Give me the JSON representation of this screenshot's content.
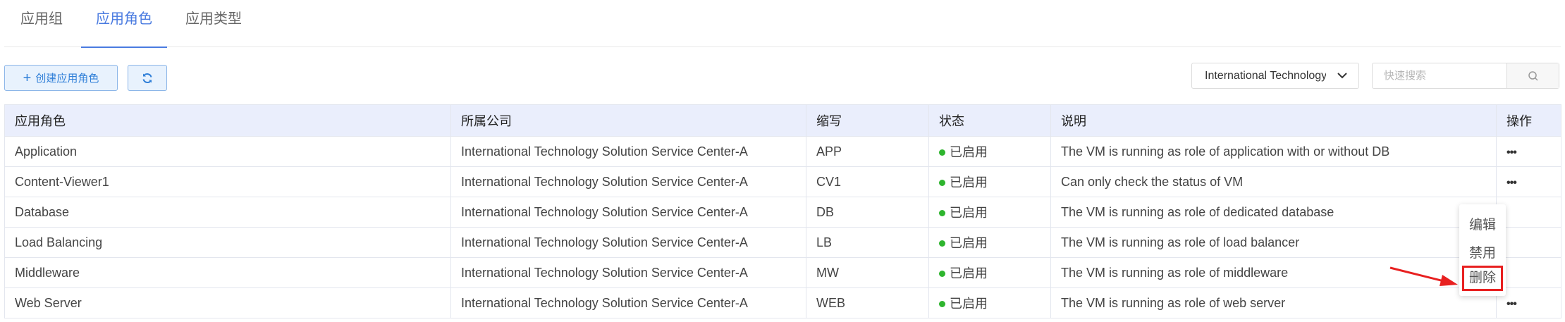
{
  "tabs": [
    {
      "label": "应用组",
      "active": false
    },
    {
      "label": "应用角色",
      "active": true
    },
    {
      "label": "应用类型",
      "active": false
    }
  ],
  "toolbar": {
    "create_label": "创建应用角色",
    "refresh_icon": "refresh-icon",
    "company_select": "International Technology Solution Service Center-A",
    "search_placeholder": "快速搜索",
    "search_icon": "search-icon"
  },
  "table": {
    "headers": [
      "应用角色",
      "所属公司",
      "缩写",
      "状态",
      "说明",
      "操作"
    ],
    "rows": [
      {
        "role": "Application",
        "company": "International Technology Solution Service Center-A",
        "abbr": "APP",
        "status": "已启用",
        "desc": "The VM is running as role of application with or without DB",
        "action": "•••"
      },
      {
        "role": "Content-Viewer1",
        "company": "International Technology Solution Service Center-A",
        "abbr": "CV1",
        "status": "已启用",
        "desc": "Can only check the status of VM",
        "action": "•••"
      },
      {
        "role": "Database",
        "company": "International Technology Solution Service Center-A",
        "abbr": "DB",
        "status": "已启用",
        "desc": "The VM is running as role of dedicated database",
        "action": ""
      },
      {
        "role": "Load Balancing",
        "company": "International Technology Solution Service Center-A",
        "abbr": "LB",
        "status": "已启用",
        "desc": "The VM is running as role of load balancer",
        "action": ""
      },
      {
        "role": "Middleware",
        "company": "International Technology Solution Service Center-A",
        "abbr": "MW",
        "status": "已启用",
        "desc": "The VM is running as role of middleware",
        "action": ""
      },
      {
        "role": "Web Server",
        "company": "International Technology Solution Service Center-A",
        "abbr": "WEB",
        "status": "已启用",
        "desc": "The VM is running as role of web server",
        "action": "•••"
      }
    ]
  },
  "menu": {
    "edit": "编辑",
    "disable": "禁用",
    "delete": "删除"
  },
  "colors": {
    "accent": "#4a7be0",
    "status_enabled": "#2eb52e",
    "highlight": "#e82020"
  }
}
